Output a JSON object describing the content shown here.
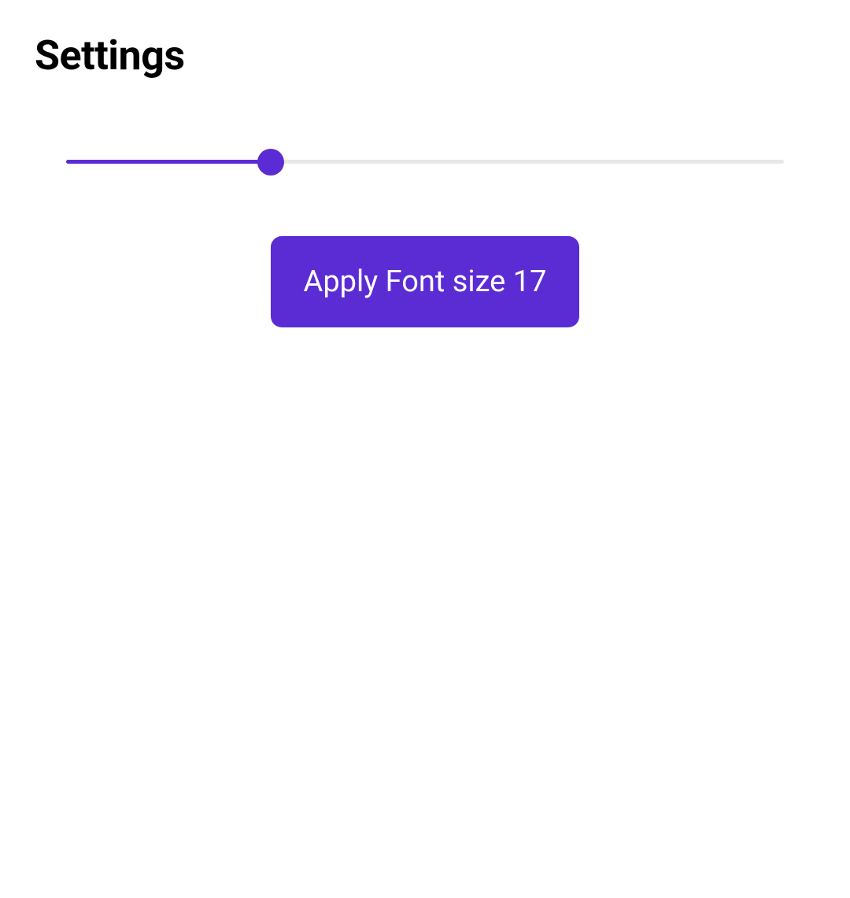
{
  "header": {
    "title": "Settings"
  },
  "slider": {
    "min": 10,
    "max": 35,
    "value": 17,
    "percent": 28.5
  },
  "button": {
    "label_prefix": "Apply Font size",
    "font_size_value": 17,
    "full_label": "Apply Font size 17"
  },
  "colors": {
    "accent": "#5b2cd4",
    "track": "#e8e8e8",
    "text": "#000000",
    "button_text": "#ffffff"
  }
}
